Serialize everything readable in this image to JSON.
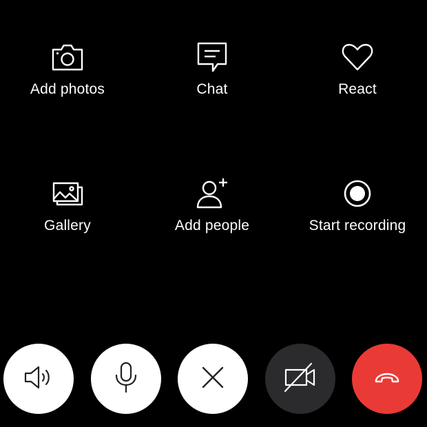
{
  "actions": [
    {
      "label": "Add photos",
      "icon": "camera-icon"
    },
    {
      "label": "Chat",
      "icon": "chat-icon"
    },
    {
      "label": "React",
      "icon": "heart-icon"
    },
    {
      "label": "Gallery",
      "icon": "gallery-icon"
    },
    {
      "label": "Add people",
      "icon": "add-person-icon"
    },
    {
      "label": "Start recording",
      "icon": "record-icon"
    }
  ],
  "call_controls": [
    {
      "name": "speaker",
      "icon": "speaker-icon",
      "style": "white"
    },
    {
      "name": "microphone",
      "icon": "microphone-icon",
      "style": "white"
    },
    {
      "name": "close",
      "icon": "close-icon",
      "style": "white"
    },
    {
      "name": "video-off",
      "icon": "video-off-icon",
      "style": "dark"
    },
    {
      "name": "end-call",
      "icon": "end-call-icon",
      "style": "red"
    }
  ],
  "colors": {
    "background": "#000000",
    "text": "#ffffff",
    "control_light": "#ffffff",
    "control_dark": "#2b2b2d",
    "end_call": "#ea3a36"
  }
}
